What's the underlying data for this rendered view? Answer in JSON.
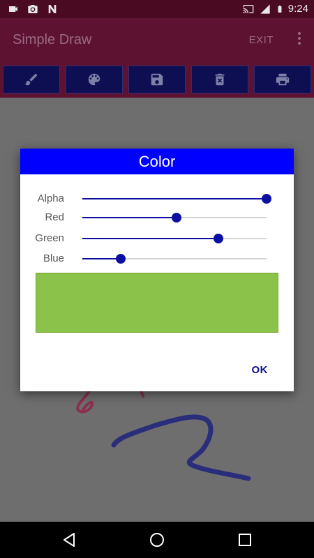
{
  "status_bar": {
    "time": "9:24",
    "icons_left": [
      "video-icon",
      "camera-icon",
      "n-notification-icon"
    ],
    "icons_right": [
      "cast-icon",
      "signal-icon",
      "battery-icon"
    ]
  },
  "app_bar": {
    "title": "Simple Draw",
    "exit_label": "EXIT",
    "overflow_icon": "more-vert-icon"
  },
  "toolbar": {
    "buttons": [
      {
        "icon": "brush-icon"
      },
      {
        "icon": "palette-icon"
      },
      {
        "icon": "save-icon"
      },
      {
        "icon": "delete-icon"
      },
      {
        "icon": "print-icon"
      }
    ]
  },
  "dialog": {
    "title": "Color",
    "sliders": [
      {
        "label": "Alpha",
        "value": 1.0
      },
      {
        "label": "Red",
        "value": 0.51
      },
      {
        "label": "Green",
        "value": 0.74
      },
      {
        "label": "Blue",
        "value": 0.21
      }
    ],
    "preview_color": "#8bc34a",
    "ok_label": "OK"
  },
  "colors": {
    "accent": "#0000ff",
    "slider": "#0d0fa0",
    "app_bar": "#5e1232"
  }
}
